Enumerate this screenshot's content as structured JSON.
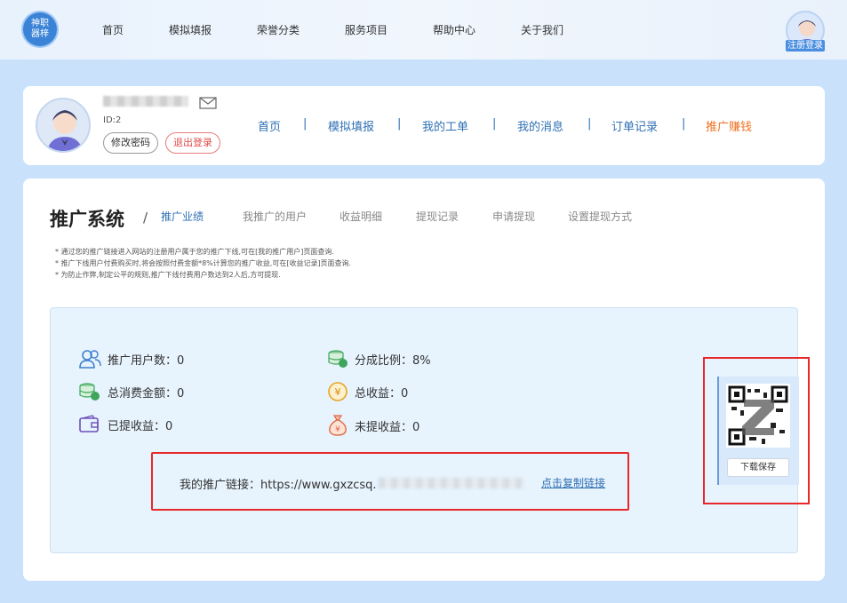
{
  "topbar": {
    "logo_text": "神职\n器梓",
    "nav": [
      "首页",
      "模拟填报",
      "荣誉分类",
      "服务项目",
      "帮助中心",
      "关于我们"
    ],
    "login_label": "注册登录"
  },
  "user": {
    "id_text": "ID:2",
    "change_pwd": "修改密码",
    "logout": "退出登录",
    "nav": [
      "首页",
      "模拟填报",
      "我的工单",
      "我的消息",
      "订单记录",
      "推广赚钱"
    ],
    "separator": "|"
  },
  "panel": {
    "title": "推广系统",
    "slash": "/",
    "tabs": [
      "推广业绩",
      "我推广的用户",
      "收益明细",
      "提现记录",
      "申请提现",
      "设置提现方式"
    ],
    "notes": [
      "* 通过您的推广链接进入网站的注册用户属于您的推广下线,可在[我的推广用户]页面查询.",
      "* 推广下线用户付费购买时,将会按照付费金额*8%计算您的推广收益,可在[收益记录]页面查询.",
      "* 为防止作弊,制定公平的规则,推广下线付费用户数达到2人后,方可提现."
    ]
  },
  "stats": {
    "promo_users": "推广用户数：0",
    "share_ratio": "分成比例：8%",
    "total_spend": "总消费金额：0",
    "total_income": "总收益：0",
    "withdrawn": "已提收益：0",
    "not_withdrawn": "未提收益：0"
  },
  "link": {
    "label": "我的推广链接：https://www.gxzcsq.",
    "copy": "点击复制链接"
  },
  "qr": {
    "save": "下载保存"
  },
  "colors": {
    "accent": "#2f6fb3",
    "active_orange": "#f07023",
    "highlight_red": "#e8282a",
    "background": "#c9e1fb"
  }
}
